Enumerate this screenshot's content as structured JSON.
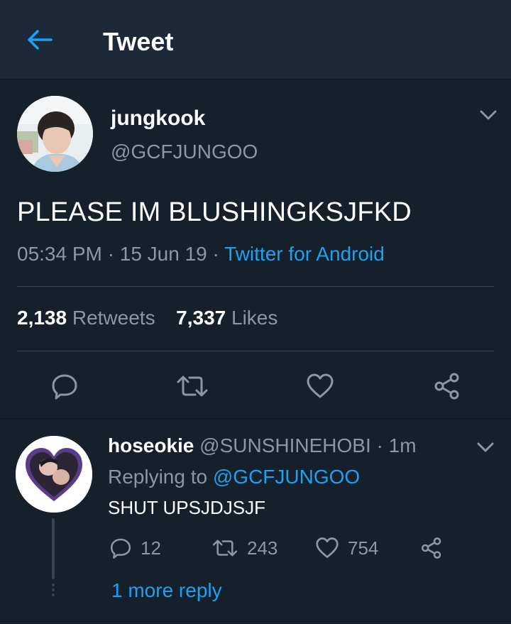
{
  "header": {
    "title": "Tweet",
    "back_icon": "back-arrow-icon",
    "accent": "#1da1f2"
  },
  "tweet": {
    "display_name": "jungkook",
    "handle": "@GCFJUNGOO",
    "text": "PLEASE IM BLUSHINGKSJFKD",
    "time": "05:34 PM",
    "sep1": " · ",
    "date": "15 Jun 19",
    "sep2": " · ",
    "source": "Twitter for Android",
    "retweets_count": "2,138",
    "retweets_label": "Retweets",
    "likes_count": "7,337",
    "likes_label": "Likes",
    "actions": [
      "reply-icon",
      "retweet-icon",
      "like-icon",
      "share-icon"
    ]
  },
  "reply": {
    "display_name": "hoseokie",
    "handle": "@SUNSHINEHOBI",
    "time": " · 1m",
    "replying_prefix": "Replying to ",
    "replying_to": "@GCFJUNGOO",
    "text": "SHUT UPSJDJSJF",
    "reply_count": "12",
    "retweet_count": "243",
    "like_count": "754",
    "more_replies": "1 more reply"
  },
  "colors": {
    "background": "#15202b",
    "header_bg": "#1c2938",
    "secondary_text": "#8899a6",
    "link": "#1da1f2",
    "divider": "#38444d"
  }
}
